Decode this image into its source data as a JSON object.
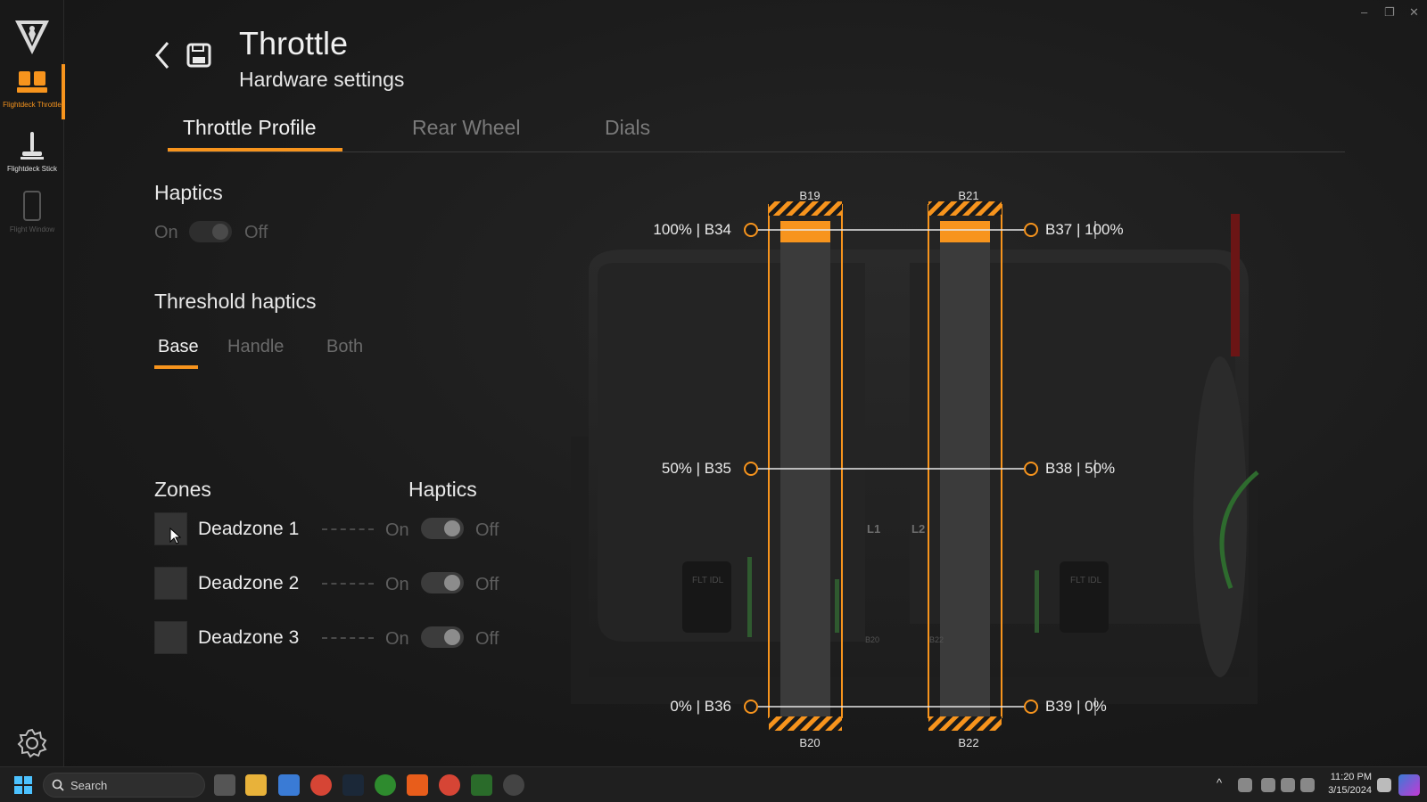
{
  "window": {
    "controls": [
      "–",
      "❐",
      "✕"
    ]
  },
  "sidebar": {
    "logo": "turtle-beach-logo-icon",
    "items": [
      {
        "label": "Flightdeck Throttle",
        "icon": "throttle-icon",
        "active": true
      },
      {
        "label": "Flightdeck Stick",
        "icon": "joystick-icon",
        "active": false
      },
      {
        "label": "Flight Window",
        "icon": "phone-icon",
        "active": false
      }
    ],
    "settings_icon": "gear-icon"
  },
  "header": {
    "title": "Throttle",
    "subtitle": "Hardware settings",
    "back_icon": "back-arrow-icon",
    "save_icon": "save-icon"
  },
  "tabs": [
    {
      "label": "Throttle Profile",
      "active": true
    },
    {
      "label": "Rear Wheel",
      "active": false
    },
    {
      "label": "Dials",
      "active": false
    }
  ],
  "haptics": {
    "title": "Haptics",
    "on": "On",
    "off": "Off"
  },
  "threshold": {
    "title": "Threshold haptics",
    "subtabs": [
      {
        "label": "Base",
        "active": true
      },
      {
        "label": "Handle",
        "active": false
      },
      {
        "label": "Both",
        "active": false
      }
    ]
  },
  "zones": {
    "title": "Zones",
    "haptics_title": "Haptics",
    "items": [
      {
        "label": "Deadzone 1",
        "on": "On",
        "off": "Off"
      },
      {
        "label": "Deadzone 2",
        "on": "On",
        "off": "Off"
      },
      {
        "label": "Deadzone 3",
        "on": "On",
        "off": "Off"
      }
    ]
  },
  "diagram": {
    "top_labels": [
      "B19",
      "B21"
    ],
    "bottom_labels": [
      "B20",
      "B22"
    ],
    "left_markers": [
      "100% | B34",
      "50% | B35",
      "0% | B36"
    ],
    "right_markers": [
      "B37 | 100%",
      "B38 | 50%",
      "B39 | 0%"
    ],
    "lever_labels": [
      "L1",
      "L2"
    ],
    "small_labels": [
      "FLT IDL",
      "FLT IDL",
      "B20",
      "B22"
    ],
    "accent": "#f7941d"
  },
  "taskbar": {
    "search_placeholder": "Search",
    "time": "11:20 PM",
    "date": "3/15/2024"
  }
}
